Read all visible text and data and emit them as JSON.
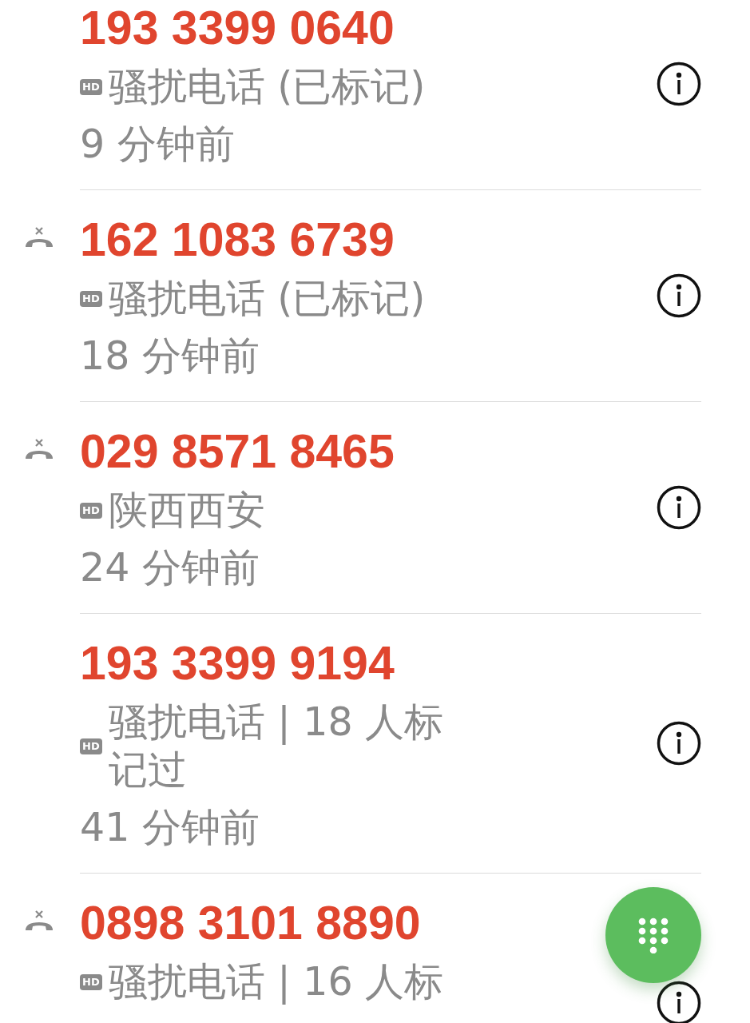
{
  "calls": [
    {
      "number": "193 3399 0640",
      "missed": false,
      "badge": "HD",
      "label": "骚扰电话 (已标记)",
      "time": "9 分钟前"
    },
    {
      "number": "162 1083 6739",
      "missed": true,
      "badge": "HD",
      "label": "骚扰电话 (已标记)",
      "time": "18 分钟前"
    },
    {
      "number": "029 8571 8465",
      "missed": true,
      "badge": "HD",
      "label": "陕西西安",
      "time": "24 分钟前"
    },
    {
      "number": "193 3399 9194",
      "missed": false,
      "badge": "HD",
      "label": "骚扰电话 | 18 人标记过",
      "time": "41 分钟前"
    },
    {
      "number": "0898 3101 8890",
      "missed": true,
      "badge": "HD",
      "label": "骚扰电话 | 16 人标"
    }
  ]
}
